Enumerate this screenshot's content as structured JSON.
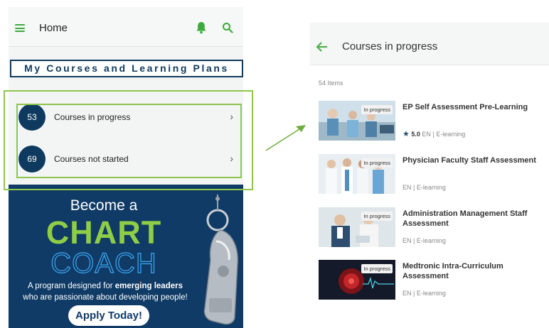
{
  "left_screen": {
    "title": "Home",
    "banner": "My Courses and Learning Plans",
    "rows": [
      {
        "count": "53",
        "label": "Courses in progress"
      },
      {
        "count": "69",
        "label": "Courses not started"
      }
    ],
    "promo": {
      "line1": "Become a",
      "line2": "CHART",
      "line3": "COACH",
      "desc_prefix": "A program designed for ",
      "desc_bold": "emerging leaders",
      "desc_line2": "who are passionate about developing people!",
      "button": "Apply Today!"
    }
  },
  "right_screen": {
    "title": "Courses in progress",
    "items_count": "54 Items",
    "courses": [
      {
        "title": "EP Self Assessment Pre-Learning",
        "badge": "In progress",
        "rating": "5.0",
        "meta": "EN | E-learning"
      },
      {
        "title": "Physician Faculty Staff Assessment",
        "badge": "In progress",
        "meta": "EN | E-learning"
      },
      {
        "title": "Administration Management Staff Assessment",
        "badge": "In progress",
        "meta": "EN | E-learning"
      },
      {
        "title": "Medtronic Intra-Curriculum Assessment",
        "badge": "In progress",
        "meta": "EN | E-learning"
      }
    ]
  },
  "colors": {
    "accent_green": "#3cab3c",
    "navy": "#0f3a5c",
    "highlight": "#8dc54d",
    "chart_green": "#8fcd46",
    "coach_blue": "#3fa9f5"
  },
  "icons": [
    "menu-icon",
    "bell-icon",
    "search-icon",
    "chevron-right-icon",
    "back-arrow-icon",
    "star-icon",
    "whistle-icon"
  ]
}
